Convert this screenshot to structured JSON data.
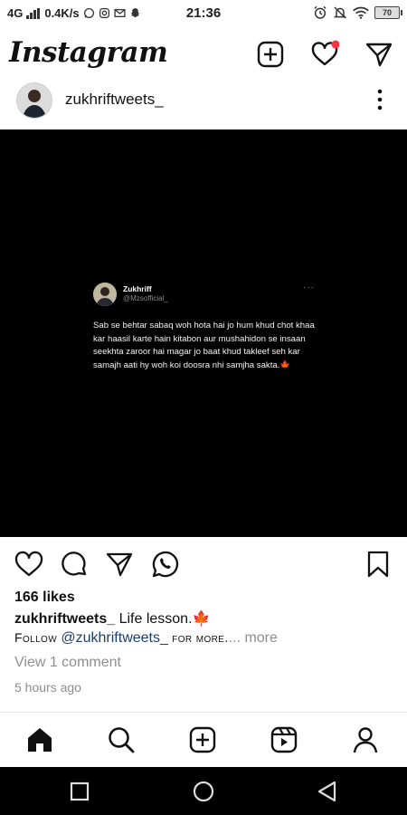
{
  "status_bar": {
    "network": "4G",
    "speed": "0.4K/s",
    "time": "21:36",
    "battery": "70"
  },
  "header": {
    "logo": "Instagram"
  },
  "post": {
    "username": "zukhriftweets_",
    "tweet": {
      "name": "Zukhriff",
      "handle": "@Mzsofficial_",
      "text": "Sab se behtar sabaq woh hota hai jo hum khud chot khaa kar haasil karte hain kitabon aur mushahidon se insaan seekhta zaroor hai magar jo baat khud takleef seh kar samajh aati hy woh koi doosra nhi samjha sakta.🍁"
    },
    "likes": "166 likes",
    "caption_user": "zukhriftweets_",
    "caption_text": " Life lesson.🍁",
    "cta_follow": "Follow ",
    "cta_mention": "@zukhriftweets_",
    "cta_for_more": " for more.",
    "more_label": "... more",
    "view_comments": "View 1 comment",
    "timestamp": "5 hours ago"
  },
  "colors": {
    "accent_red": "#ff3040",
    "mention_blue": "#1c3e6e",
    "muted": "#8e8e8e"
  },
  "bottom_nav": [
    "home-icon",
    "search-icon",
    "create-icon",
    "reels-icon",
    "profile-icon"
  ]
}
